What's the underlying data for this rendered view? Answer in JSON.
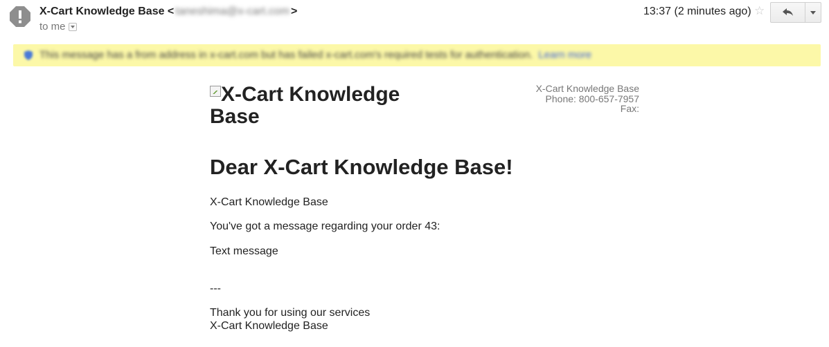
{
  "header": {
    "sender_name": "X-Cart Knowledge Base",
    "sender_email": "taneshima@x-cart.com",
    "email_open": " <",
    "email_close": ">",
    "recipient": "to me",
    "time": "13:37 (2 minutes ago)",
    "icons": {
      "avatar": "unknown-sender-icon",
      "star": "star-icon",
      "reply": "reply-icon",
      "more": "chevron-down-icon"
    }
  },
  "banner": {
    "text": "This message has a from address in x-cart.com but has failed x-cart.com's required tests for authentication.",
    "link": "Learn more",
    "icon": "shield-icon",
    "color": "#fcf8a8"
  },
  "email": {
    "logo_alt": "X-Cart Knowledge Base",
    "company": {
      "name": "X-Cart Knowledge Base",
      "phone": "Phone: 800-657-7957",
      "fax": "Fax:"
    },
    "greeting": "Dear X-Cart Knowledge Base!",
    "line1": "X-Cart Knowledge Base",
    "line2": "You've got a message regarding your order 43:",
    "line3": "Text message",
    "separator": "---",
    "thanks": "Thank you for using our services",
    "signature": "X-Cart Knowledge Base"
  }
}
